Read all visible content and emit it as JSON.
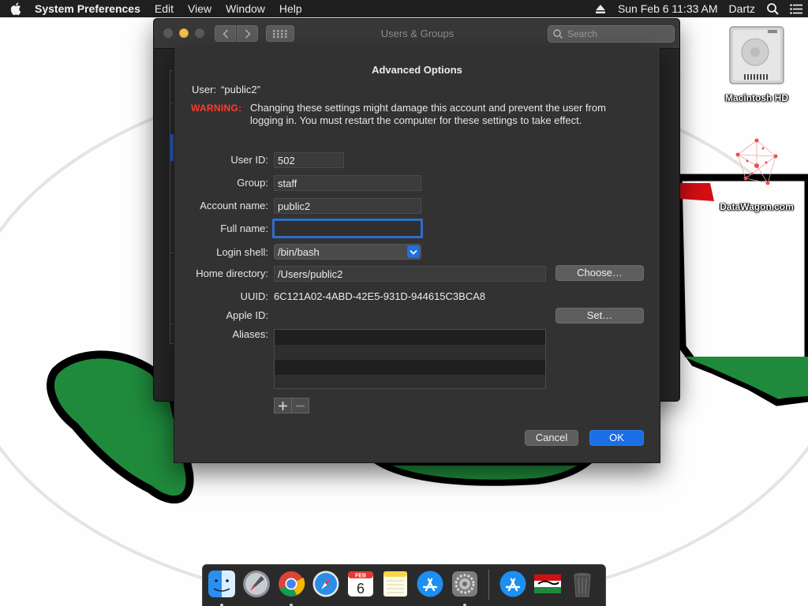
{
  "menubar": {
    "app_name": "System Preferences",
    "menus": [
      "Edit",
      "View",
      "Window",
      "Help"
    ],
    "date_time": "Sun Feb 6  11:33 AM",
    "user": "Dartz"
  },
  "desktop": {
    "icons": [
      {
        "label": "Macintosh HD",
        "icon": "hard-drive-icon"
      },
      {
        "label": "DataWagon.com",
        "icon": "network-graph-icon"
      }
    ]
  },
  "window": {
    "title": "Users & Groups",
    "search_placeholder": "Search"
  },
  "sheet": {
    "title": "Advanced Options",
    "user_label": "User:",
    "user_value": "“public2”",
    "warning_label": "WARNING:",
    "warning_text": "Changing these settings might damage this account and prevent the user from logging in. You must restart the computer for these settings to take effect.",
    "fields": {
      "user_id": {
        "label": "User ID:",
        "value": "502"
      },
      "group": {
        "label": "Group:",
        "value": "staff"
      },
      "account_name": {
        "label": "Account name:",
        "value": "public2"
      },
      "full_name": {
        "label": "Full name:",
        "value": ""
      },
      "login_shell": {
        "label": "Login shell:",
        "value": "/bin/bash"
      },
      "home_directory": {
        "label": "Home directory:",
        "value": "/Users/public2"
      },
      "uuid": {
        "label": "UUID:",
        "value": "6C121A02-4ABD-42E5-931D-944615C3BCA8"
      },
      "apple_id": {
        "label": "Apple ID:",
        "value": ""
      },
      "aliases": {
        "label": "Aliases:",
        "items": []
      }
    },
    "choose_button": "Choose…",
    "set_button": "Set…",
    "cancel_button": "Cancel",
    "ok_button": "OK"
  },
  "dock": {
    "apps": [
      "finder-icon",
      "launchpad-icon",
      "chrome-icon",
      "safari-icon",
      "calendar-icon",
      "notes-icon",
      "app-store-icon",
      "system-preferences-icon",
      "app-store-icon",
      "flag-app-icon",
      "trash-icon"
    ],
    "calendar": {
      "month": "FEB",
      "day": "6"
    }
  },
  "colors": {
    "accent": "#1b6fe6",
    "warning": "#ff3b30",
    "wallpaper_green": "#1f8a3c",
    "wallpaper_red": "#d20f14"
  }
}
